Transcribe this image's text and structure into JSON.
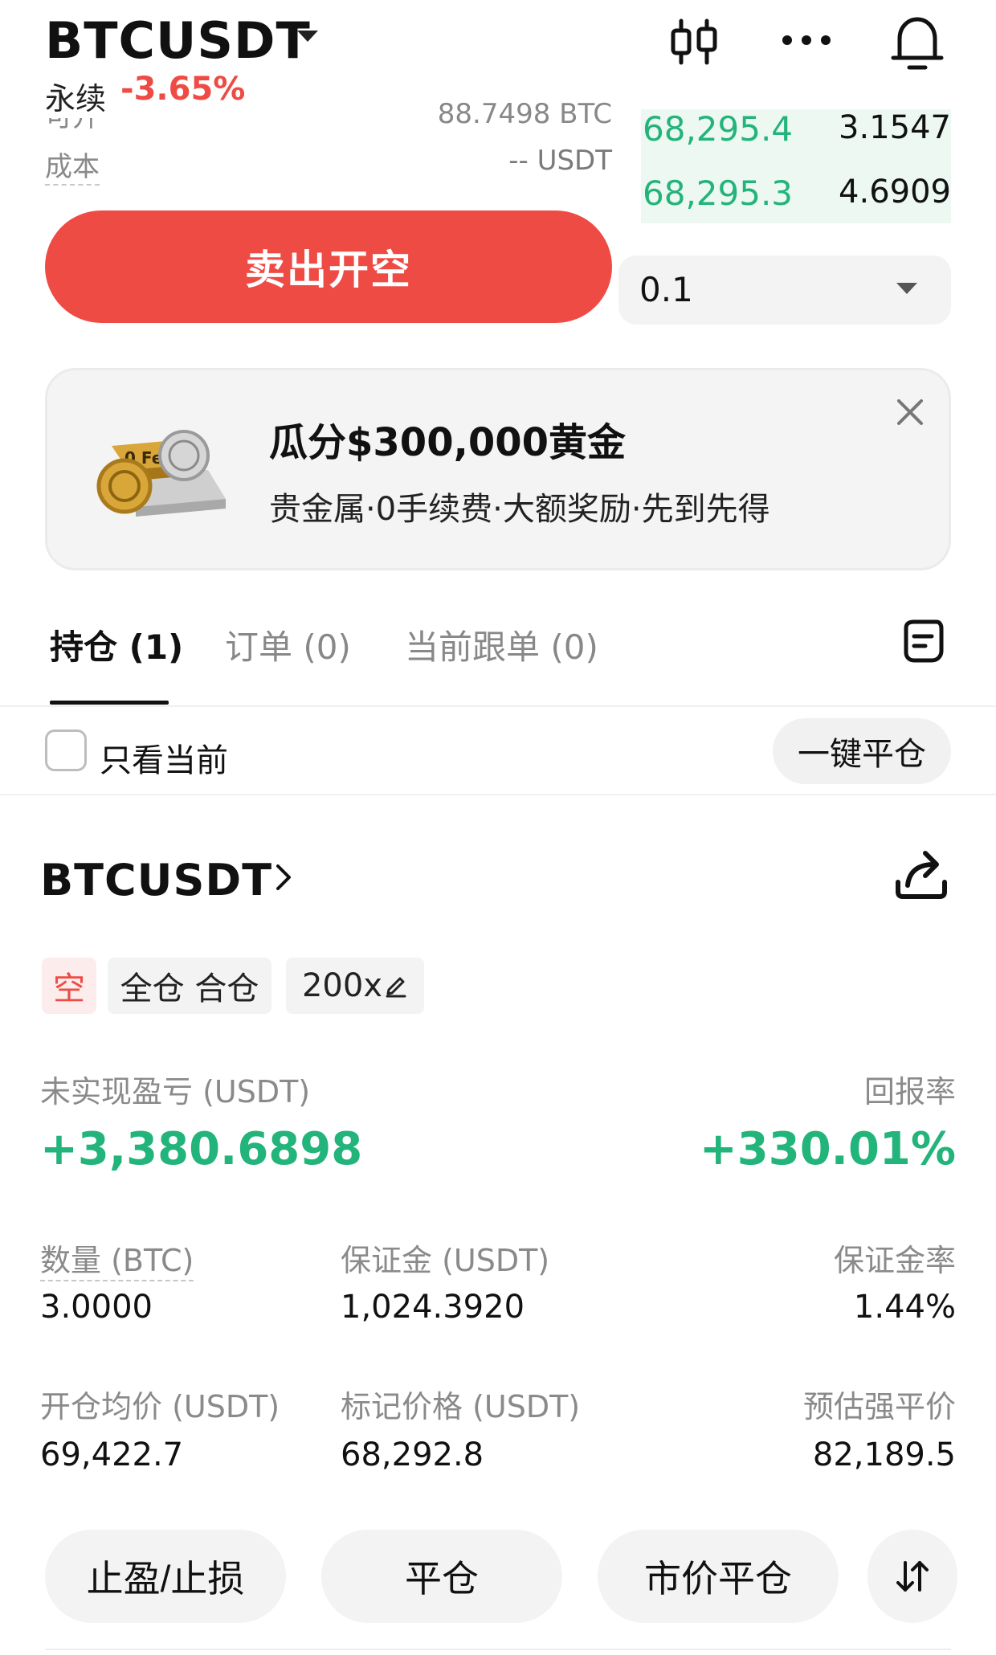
{
  "header": {
    "symbol": "BTCUSDT",
    "contract_type": "永续",
    "change_pct": "-3.65%",
    "icons": [
      "candlestick-chart-icon",
      "more-icon",
      "bell-icon"
    ]
  },
  "order_form": {
    "available_label": "可开",
    "available_value": "88.7498 BTC",
    "cost_label": "成本",
    "cost_value": "-- USDT",
    "sell_button_label": "卖出开空",
    "quantity_value": "0.1"
  },
  "orderbook": {
    "rows": [
      {
        "price": "68,295.4",
        "qty": "3.1547"
      },
      {
        "price": "68,295.3",
        "qty": "4.6909"
      }
    ]
  },
  "promo": {
    "title": "瓜分$300,000黄金",
    "subtitle": "贵金属·0手续费·大额奖励·先到先得",
    "art_text": "0 Fees"
  },
  "tabs": {
    "items": [
      {
        "label": "持仓 (1)"
      },
      {
        "label": "订单 (0)"
      },
      {
        "label": "当前跟单 (0)"
      }
    ]
  },
  "filter": {
    "only_current_label": "只看当前",
    "close_all_label": "一键平仓"
  },
  "position": {
    "symbol": "BTCUSDT",
    "side_tag": "空",
    "margin_mode_tag": "全仓 合仓",
    "leverage_tag": "200x",
    "unrealized_pnl_label": "未实现盈亏 (USDT)",
    "unrealized_pnl_value": "+3,380.6898",
    "roi_label": "回报率",
    "roi_value": "+330.01%",
    "quantity_label": "数量 (BTC)",
    "quantity_value": "3.0000",
    "margin_label": "保证金 (USDT)",
    "margin_value": "1,024.3920",
    "margin_rate_label": "保证金率",
    "margin_rate_value": "1.44%",
    "entry_price_label": "开仓均价 (USDT)",
    "entry_price_value": "69,422.7",
    "mark_price_label": "标记价格 (USDT)",
    "mark_price_value": "68,292.8",
    "liq_price_label": "预估强平价",
    "liq_price_value": "82,189.5"
  },
  "actions": {
    "tpsl_label": "止盈/止损",
    "close_label": "平仓",
    "market_close_label": "市价平仓"
  },
  "colors": {
    "sell_red": "#ef4b45",
    "profit_green": "#22b47a",
    "orderbook_bid_bg": "#ecf8f1"
  }
}
